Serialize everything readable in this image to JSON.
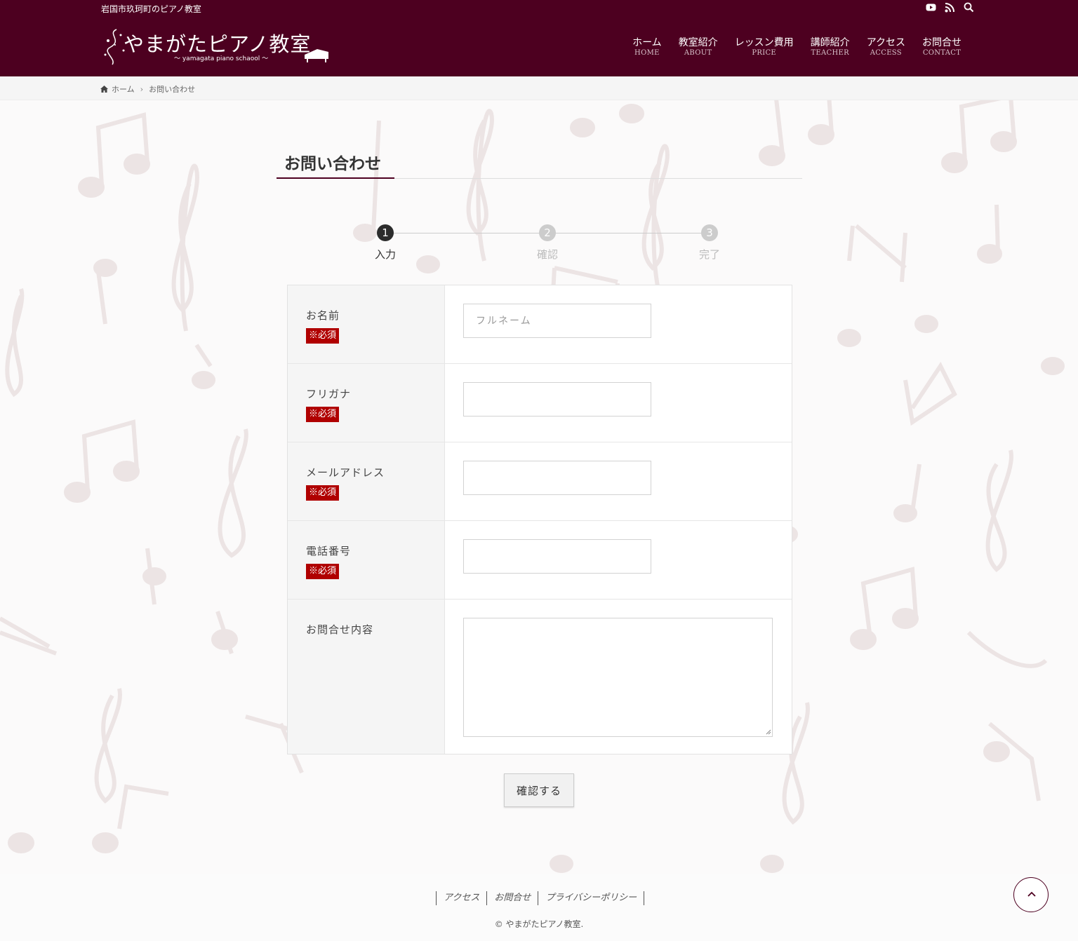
{
  "header": {
    "tagline": "岩国市玖珂町のピアノ教室",
    "logo_text": "やまがたピアノ教室",
    "logo_sub": "～ yamagata piano schaool ～",
    "icons": [
      "youtube-icon",
      "rss-icon",
      "search-icon"
    ],
    "nav": [
      {
        "jp": "ホーム",
        "en": "HOME"
      },
      {
        "jp": "教室紹介",
        "en": "ABOUT"
      },
      {
        "jp": "レッスン費用",
        "en": "PRICE"
      },
      {
        "jp": "講師紹介",
        "en": "TEACHER"
      },
      {
        "jp": "アクセス",
        "en": "ACCESS"
      },
      {
        "jp": "お問合せ",
        "en": "CONTACT"
      }
    ]
  },
  "breadcrumb": {
    "home": "ホーム",
    "current": "お問い合わせ"
  },
  "page": {
    "title": "お問い合わせ"
  },
  "steps": [
    {
      "num": "1",
      "label": "入力"
    },
    {
      "num": "2",
      "label": "確認"
    },
    {
      "num": "3",
      "label": "完了"
    }
  ],
  "form": {
    "required_label": "※必須",
    "fields": [
      {
        "label": "お名前",
        "placeholder": "フルネーム",
        "required": true
      },
      {
        "label": "フリガナ",
        "placeholder": "",
        "required": true
      },
      {
        "label": "メールアドレス",
        "placeholder": "",
        "required": true
      },
      {
        "label": "電話番号",
        "placeholder": "",
        "required": true
      },
      {
        "label": "お問合せ内容",
        "required": false
      }
    ],
    "submit_label": "確認する"
  },
  "footer": {
    "links": [
      "アクセス",
      "お問合せ",
      "プライバシーポリシー"
    ],
    "copyright": "© やまがたピアノ教室."
  },
  "colors": {
    "brand": "#4d0020",
    "required_badge": "#b00000",
    "background_notes": "#ede5e5"
  }
}
